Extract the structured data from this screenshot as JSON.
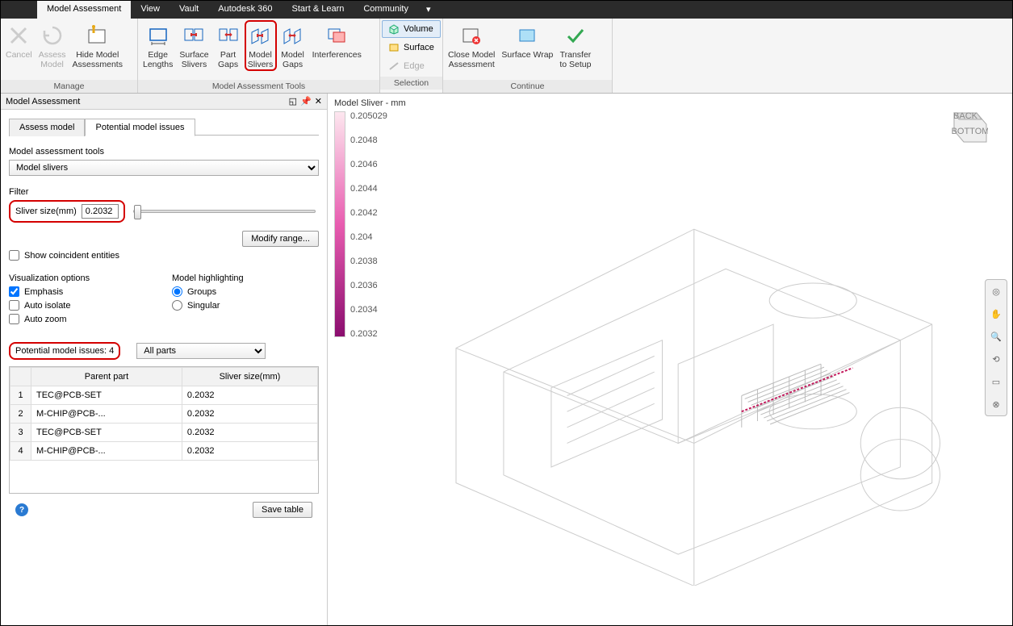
{
  "menu": {
    "tabs": [
      "Model Assessment",
      "View",
      "Vault",
      "Autodesk 360",
      "Start & Learn",
      "Community"
    ],
    "active": 0
  },
  "ribbon": {
    "groups": [
      {
        "label": "Manage",
        "buttons": [
          {
            "name": "cancel",
            "label": "Cancel",
            "disabled": true
          },
          {
            "name": "assess-model",
            "label": "Assess\nModel",
            "disabled": true
          },
          {
            "name": "hide-model-assessments",
            "label": "Hide Model\nAssessments"
          }
        ]
      },
      {
        "label": "Model Assessment Tools",
        "buttons": [
          {
            "name": "edge-lengths",
            "label": "Edge\nLengths"
          },
          {
            "name": "surface-slivers",
            "label": "Surface\nSlivers"
          },
          {
            "name": "part-gaps",
            "label": "Part\nGaps"
          },
          {
            "name": "model-slivers",
            "label": "Model\nSlivers",
            "highlighted": true
          },
          {
            "name": "model-gaps",
            "label": "Model\nGaps"
          },
          {
            "name": "interferences",
            "label": "Interferences"
          }
        ]
      },
      {
        "label": "Selection",
        "stack": [
          {
            "name": "volume",
            "label": "Volume",
            "active": true
          },
          {
            "name": "surface",
            "label": "Surface"
          },
          {
            "name": "edge",
            "label": "Edge",
            "disabled": true
          }
        ]
      },
      {
        "label": "Continue",
        "buttons": [
          {
            "name": "close-model-assessment",
            "label": "Close Model\nAssessment"
          },
          {
            "name": "surface-wrap",
            "label": "Surface Wrap"
          },
          {
            "name": "transfer-to-setup",
            "label": "Transfer\nto Setup"
          }
        ]
      }
    ]
  },
  "panel": {
    "title": "Model Assessment",
    "tabs": {
      "assess": "Assess model",
      "issues": "Potential model issues"
    },
    "tools_label": "Model assessment tools",
    "tools_value": "Model slivers",
    "filter_label": "Filter",
    "sliver_label": "Sliver size(mm)",
    "sliver_value": "0.2032",
    "modify_range": "Modify range...",
    "show_coincident": "Show coincident entities",
    "viz_label": "Visualization options",
    "highlight_label": "Model highlighting",
    "emphasis": "Emphasis",
    "auto_isolate": "Auto isolate",
    "auto_zoom": "Auto zoom",
    "groups": "Groups",
    "singular": "Singular",
    "issues_count_label": "Potential model issues:  4",
    "parts_filter": "All parts",
    "col_parent": "Parent part",
    "col_size": "Sliver size(mm)",
    "rows": [
      {
        "n": "1",
        "parent": "TEC@PCB-SET",
        "size": "0.2032"
      },
      {
        "n": "2",
        "parent": "M-CHIP@PCB-...",
        "size": "0.2032"
      },
      {
        "n": "3",
        "parent": "TEC@PCB-SET",
        "size": "0.2032"
      },
      {
        "n": "4",
        "parent": "M-CHIP@PCB-...",
        "size": "0.2032"
      }
    ],
    "save_table": "Save table"
  },
  "legend": {
    "title": "Model Sliver - mm",
    "ticks": [
      "0.205029",
      "0.2048",
      "0.2046",
      "0.2044",
      "0.2042",
      "0.204",
      "0.2038",
      "0.2036",
      "0.2034",
      "0.2032"
    ]
  },
  "viewcube": {
    "face1": "BACK",
    "face2": "BOTTOM"
  }
}
